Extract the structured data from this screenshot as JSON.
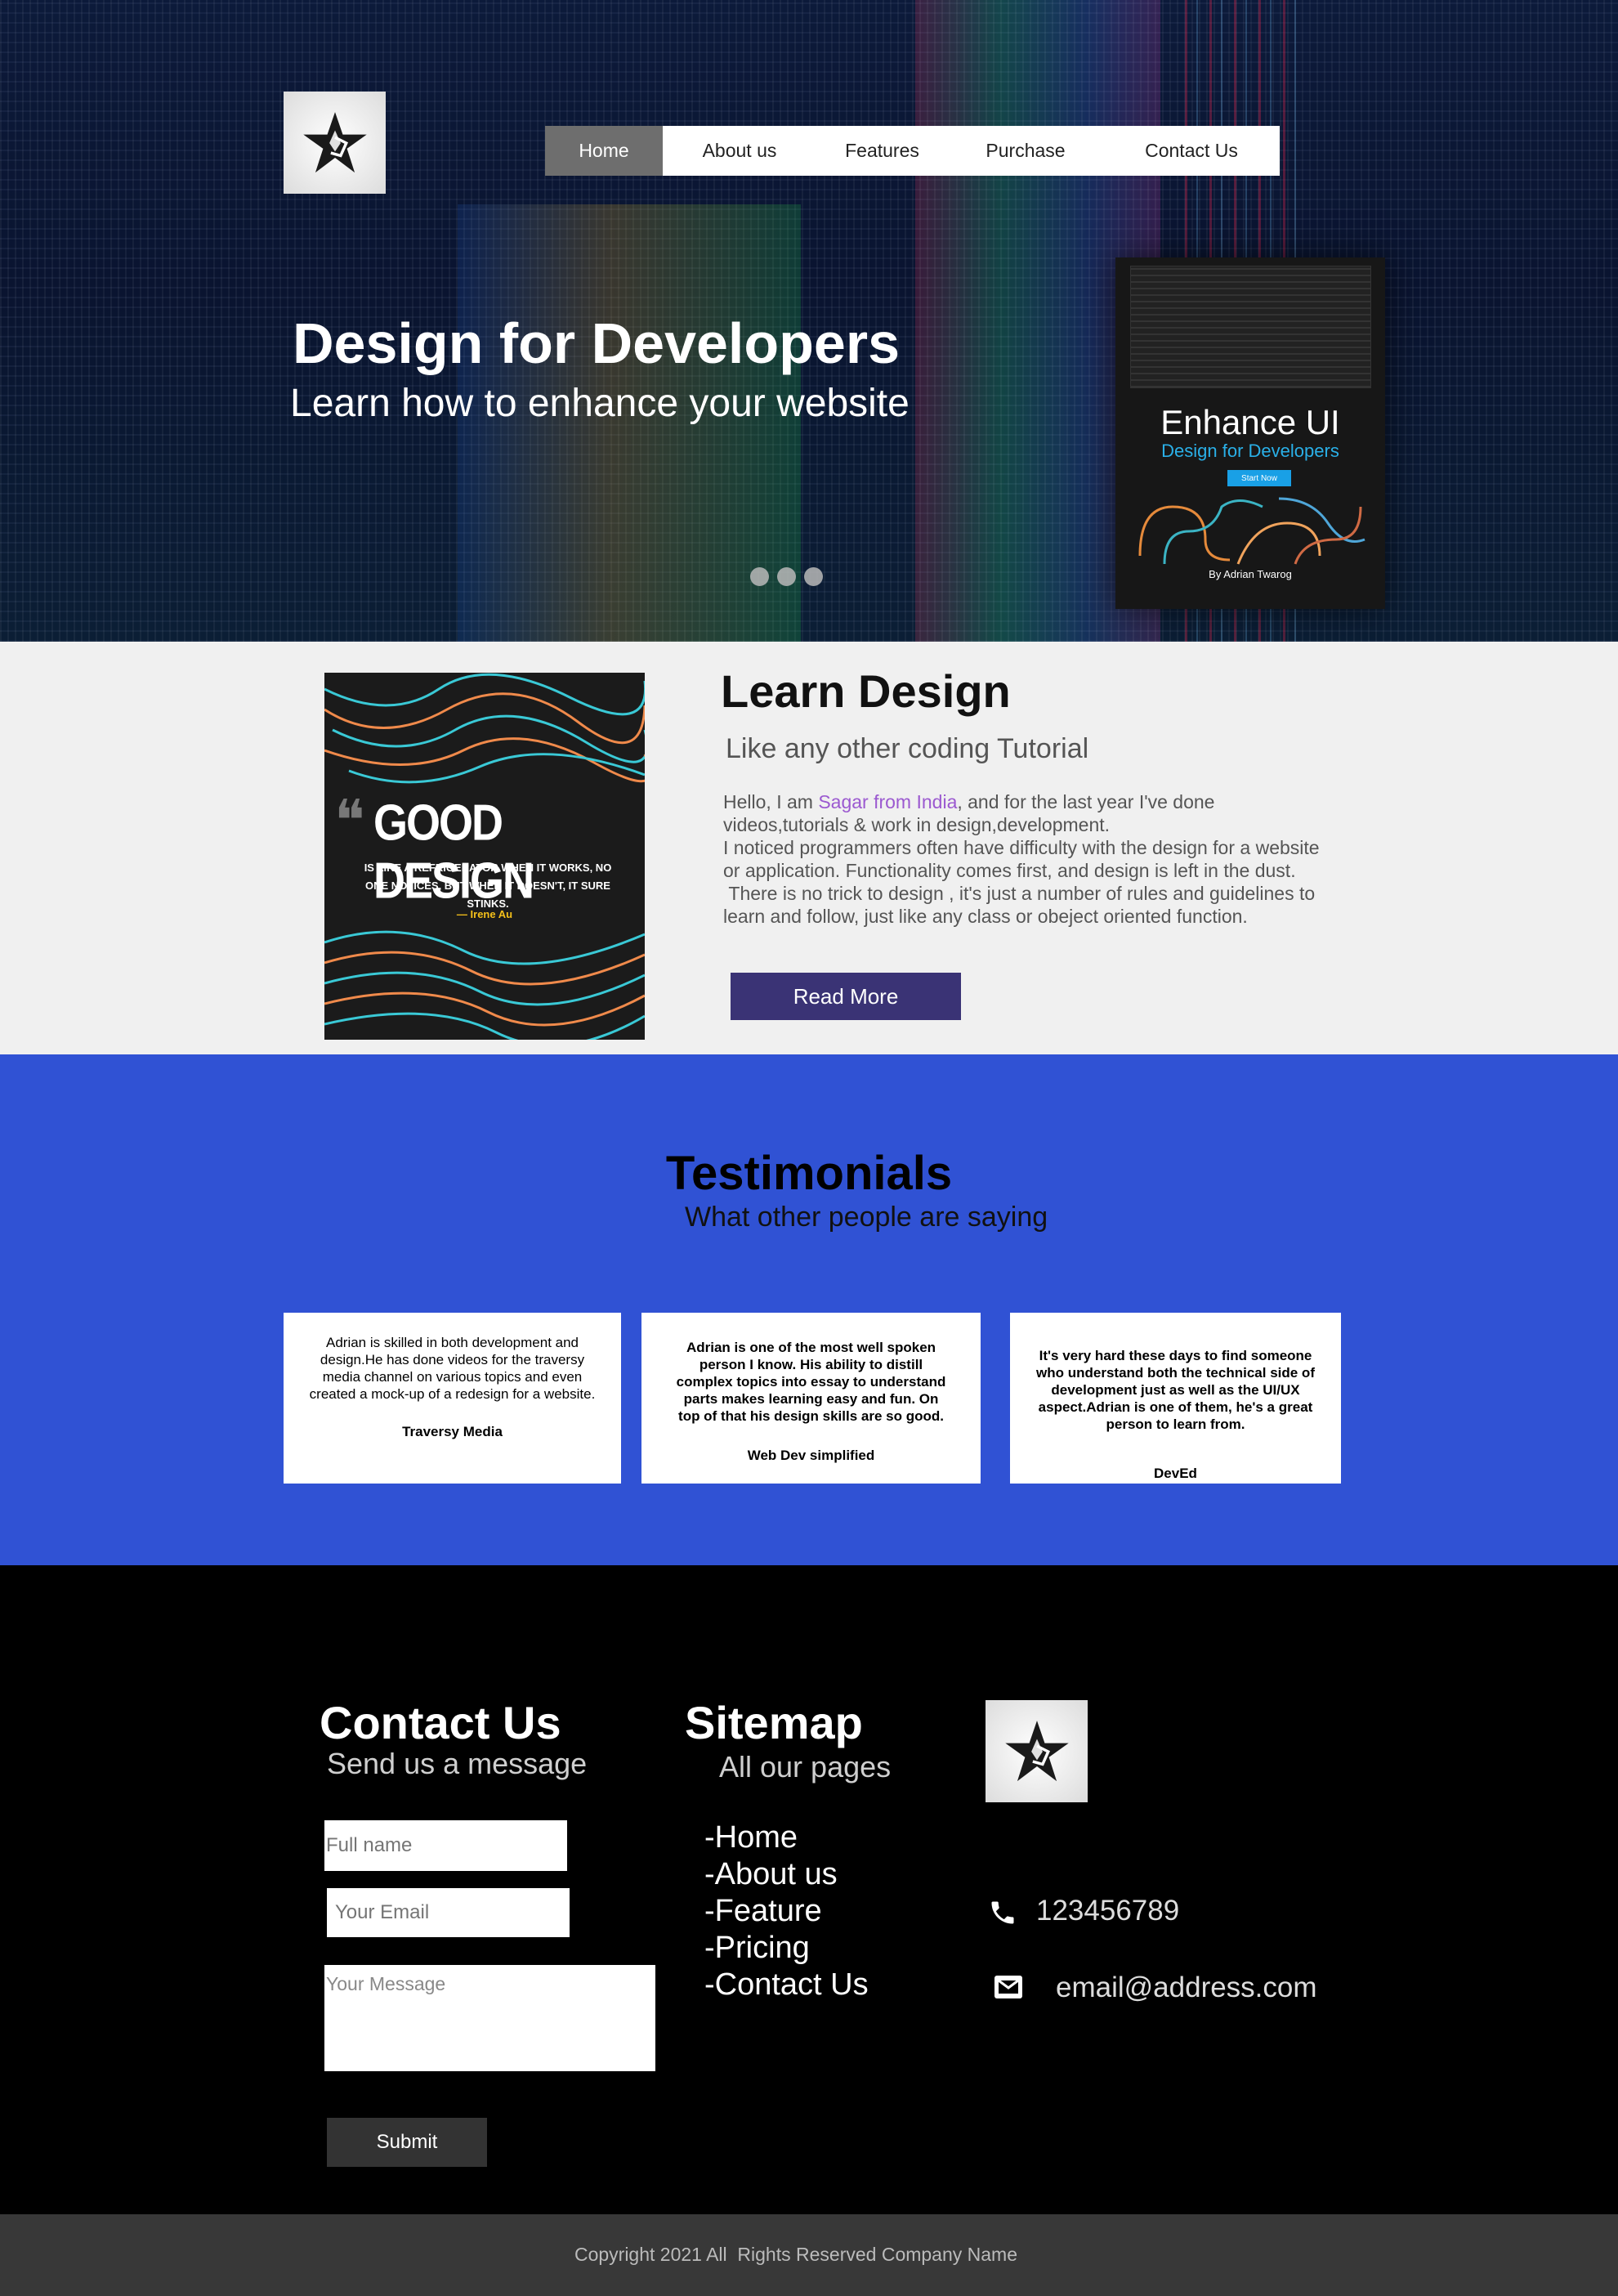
{
  "nav": {
    "items": [
      "Home",
      "About us",
      "Features",
      "Purchase",
      "Contact Us"
    ],
    "active": "Home"
  },
  "hero": {
    "title": "Design for Developers",
    "subtitle": "Learn how to enhance your website",
    "book": {
      "title": "Enhance UI",
      "subtitle": "Design for Developers",
      "button": "Start Now",
      "author": "By Adrian Twarog"
    }
  },
  "learn": {
    "poster": {
      "headline": "GOOD DESIGN",
      "quote": "IS LIKE A REFRIGERATOR WHEN IT WORKS, NO ONE NOTICES, BUT WHEN IT DOESN'T, IT SURE STINKS.",
      "author": "— Irene Au"
    },
    "title": "Learn Design",
    "subtitle": "Like any other coding Tutorial",
    "intro_prefix": "Hello, I am ",
    "intro_highlight": "Sagar from India",
    "intro_suffix": ", and for the last year I've done videos,tutorials & work in design,development.",
    "para2": "I noticed programmers often have difficulty with the design for a website or application. Functionality comes first, and design is left in the dust.",
    "para3": " There is no trick to design , it's just a number of rules and guidelines to learn and follow, just like any class or obeject oriented function.",
    "button": "Read More"
  },
  "testimonials": {
    "title": "Testimonials",
    "subtitle": "What other people are saying",
    "cards": [
      {
        "text": "Adrian is skilled in both development and design.He has done videos for the traversy media channel on various topics and even created a mock-up of a redesign for a website.",
        "name": "Traversy Media"
      },
      {
        "text": "Adrian is one of the most well spoken person I know. His ability to distill complex topics into essay to understand parts makes learning easy and fun. On top of that his design skills are so good.",
        "name": "Web Dev simplified"
      },
      {
        "text": "It's very hard these days to find someone who understand both the technical side of development just as well as the UI/UX aspect.Adrian is one of them, he's a great person to learn from.",
        "name": "DevEd"
      }
    ]
  },
  "footer": {
    "contact": {
      "title": "Contact Us",
      "subtitle": "Send us a message",
      "name_placeholder": "Full name",
      "email_placeholder": "Your Email",
      "message_placeholder": "Your Message",
      "submit": "Submit"
    },
    "sitemap": {
      "title": "Sitemap",
      "subtitle": "All our pages",
      "links": [
        "-Home",
        "-About us",
        "-Feature",
        "-Pricing",
        "-Contact Us"
      ]
    },
    "phone": "123456789",
    "email": "email@address.com",
    "copyright": "Copyright 2021 All  Rights Reserved Company Name"
  },
  "icons": [
    "star-logo-icon",
    "phone-icon",
    "envelope-icon"
  ]
}
